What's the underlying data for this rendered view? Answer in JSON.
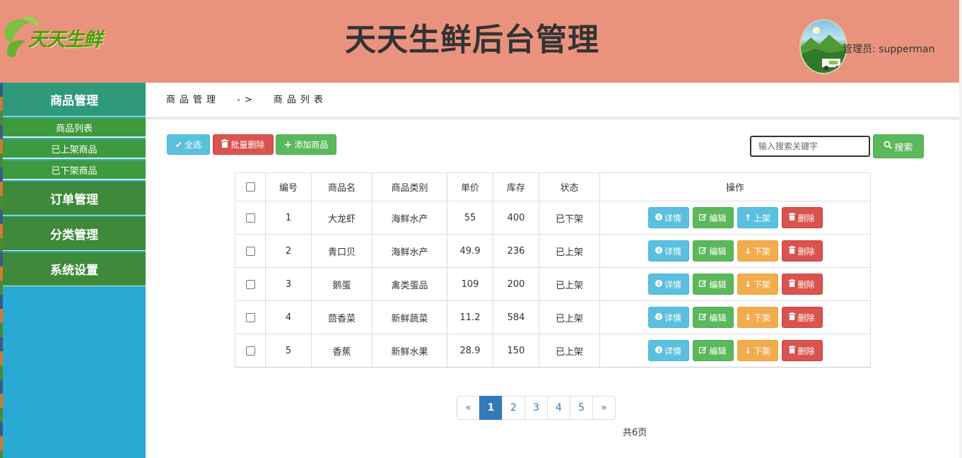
{
  "header": {
    "logo_text": "天天生鲜",
    "title": "天天生鲜后台管理",
    "admin_label": "管理员: supperman"
  },
  "sidebar": {
    "groups": [
      {
        "label": "商品管理",
        "color": "#2e9a7a"
      },
      {
        "label": "订单管理",
        "color": "#3e8a3a"
      },
      {
        "label": "分类管理",
        "color": "#3e8a3a"
      },
      {
        "label": "系统设置",
        "color": "#3e8a3a"
      }
    ],
    "items": [
      "商品列表",
      "已上架商品",
      "已下架商品"
    ]
  },
  "breadcrumb": {
    "section": "商品管理",
    "separator": "->",
    "page": "商品列表"
  },
  "toolbar": {
    "select_all": "全选",
    "batch_delete": "批量删除",
    "add_product": "添加商品",
    "search_placeholder": "输入搜索关键字",
    "search_button": "搜索"
  },
  "table": {
    "headers": [
      "编号",
      "商品名",
      "商品类别",
      "单价",
      "库存",
      "状态",
      "操作"
    ],
    "rows": [
      {
        "id": "1",
        "name": "大龙虾",
        "category": "海鲜水产",
        "price": "55",
        "stock": "400",
        "status": "已下架",
        "toggle": "上架",
        "toggle_type": "up"
      },
      {
        "id": "2",
        "name": "青口贝",
        "category": "海鲜水产",
        "price": "49.9",
        "stock": "236",
        "status": "已上架",
        "toggle": "下架",
        "toggle_type": "down"
      },
      {
        "id": "3",
        "name": "鹅蛋",
        "category": "禽类蛋品",
        "price": "109",
        "stock": "200",
        "status": "已上架",
        "toggle": "下架",
        "toggle_type": "down"
      },
      {
        "id": "4",
        "name": "茴香菜",
        "category": "新鲜蔬菜",
        "price": "11.2",
        "stock": "584",
        "status": "已上架",
        "toggle": "下架",
        "toggle_type": "down"
      },
      {
        "id": "5",
        "name": "香蕉",
        "category": "新鲜水果",
        "price": "28.9",
        "stock": "150",
        "status": "已上架",
        "toggle": "下架",
        "toggle_type": "down"
      }
    ],
    "actions": {
      "detail": "详情",
      "edit": "编辑",
      "delete": "删除"
    }
  },
  "pagination": {
    "prev": "«",
    "pages": [
      "1",
      "2",
      "3",
      "4",
      "5"
    ],
    "current": "1",
    "next": "»",
    "total": "共6页"
  },
  "colors": {
    "header_bg": "#e9937e",
    "sidebar_bg": "#29a9d4",
    "sidebar_item_bg": "#3e9a3e",
    "info": "#5bc0de",
    "danger": "#d9534f",
    "success": "#5cb85c",
    "warning": "#f0ad4e",
    "primary": "#337ab7"
  }
}
